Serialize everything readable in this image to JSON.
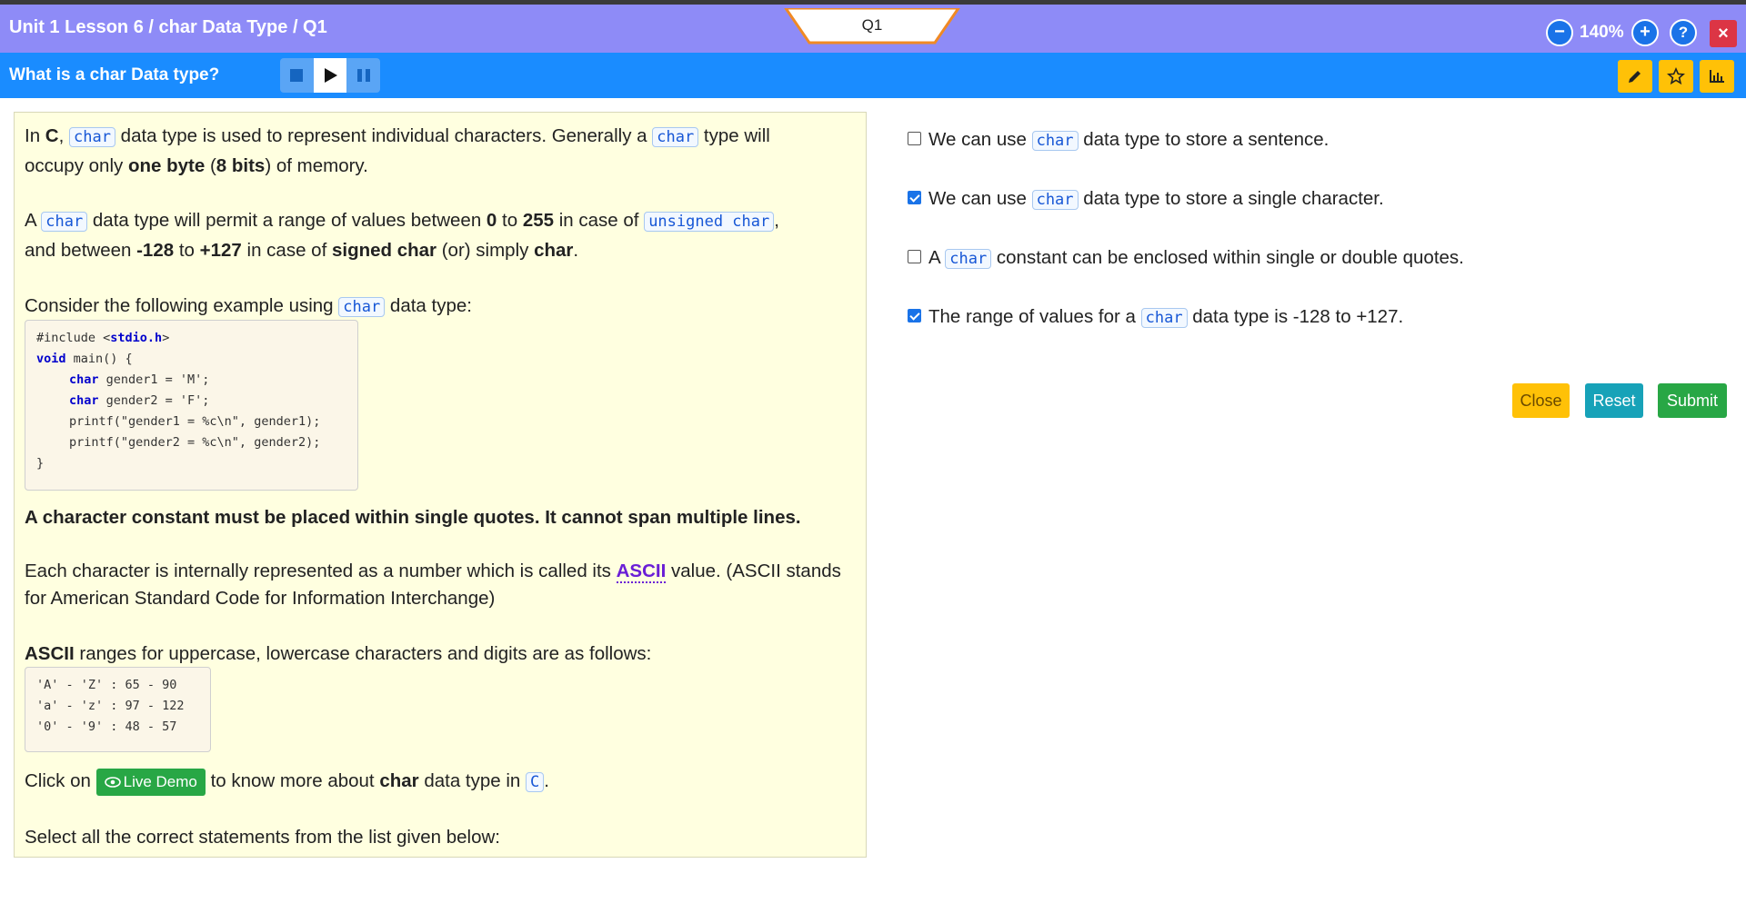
{
  "header": {
    "breadcrumb": "Unit 1 Lesson 6 / char Data Type / Q1",
    "question_tab": "Q1",
    "zoom_minus": "−",
    "zoom_level": "140%",
    "zoom_plus": "+",
    "help": "?",
    "close": "×"
  },
  "titlebar": {
    "title": "What is a char Data type?"
  },
  "content": {
    "p1": {
      "a": "In ",
      "b": "C",
      "c": ", ",
      "code1": "char",
      "d": " data type is used to represent individual characters. Generally a ",
      "code2": "char",
      "e": " type will",
      "f": "occupy only ",
      "g": "one byte",
      "h": " (",
      "i": "8 bits",
      "j": ") of memory."
    },
    "p2": {
      "a": "A ",
      "code1": "char",
      "b": " data type will permit a range of values between ",
      "c": "0",
      "d": " to ",
      "e": "255",
      "f": " in case of ",
      "code2": "unsigned char",
      "g": ",",
      "h": "and between ",
      "i": "-128",
      "j": " to ",
      "k": "+127",
      "l": " in case of ",
      "m": "signed char",
      "n": " (or) simply ",
      "o": "char",
      "p": "."
    },
    "p3": {
      "a": "Consider the following example using ",
      "code1": "char",
      "b": " data type:"
    },
    "code_example": {
      "l1a": "#include <",
      "l1b": "stdio.h",
      "l1c": ">",
      "l2a": "void",
      "l2b": " main() {",
      "l3a": "char",
      "l3b": " gender1 = 'M';",
      "l4a": "char",
      "l4b": " gender2 = 'F';",
      "l5": "printf(\"gender1 = %c\\n\", gender1);",
      "l6": "printf(\"gender2 = %c\\n\", gender2);",
      "l7": "}"
    },
    "p4": "A character constant must be placed within single quotes. It cannot span multiple lines.",
    "p5": {
      "a": "Each character is internally represented as a number which is called its ",
      "b": "ASCII",
      "c": " value. (ASCII stands",
      "d": "for American Standard Code for Information Interchange)"
    },
    "p6": {
      "a": "ASCII",
      "b": " ranges for uppercase, lowercase characters and digits are as follows:"
    },
    "ascii_table": [
      "'A' - 'Z' : 65 - 90",
      "'a' - 'z' : 97 - 122",
      "'0' - '9' : 48 - 57"
    ],
    "p7": {
      "a": "Click on ",
      "btn": "Live Demo",
      "b": " to know more about ",
      "c": "char",
      "d": " data type in ",
      "code1": "C",
      "e": "."
    },
    "p8": "Select all the correct statements from the list given below:"
  },
  "options": [
    {
      "a": "We can use ",
      "code": "char",
      "b": " data type to store a sentence.",
      "checked": false
    },
    {
      "a": "We can use ",
      "code": "char",
      "b": " data type to store a single character.",
      "checked": true
    },
    {
      "a": "A ",
      "code": "char",
      "b": " constant can be enclosed within single or double quotes.",
      "checked": false
    },
    {
      "a": "The range of values for a ",
      "code": "char",
      "b": " data type is -128 to +127.",
      "checked": true
    }
  ],
  "buttons": {
    "close": "Close",
    "reset": "Reset",
    "submit": "Submit"
  },
  "icons": {
    "stop": "stop-icon",
    "play": "play-icon",
    "pause": "pause-icon",
    "pencil": "pencil-icon",
    "star": "star-icon",
    "chart": "bar-chart-icon",
    "eye": "eye-icon"
  },
  "colors": {
    "topbar": "#8e8bf7",
    "titlebar": "#1a8cff",
    "panel": "#ffffe0",
    "close_btn": "#ffc107",
    "reset_btn": "#17a2b8",
    "submit_btn": "#28a745",
    "live_demo": "#28a745"
  }
}
